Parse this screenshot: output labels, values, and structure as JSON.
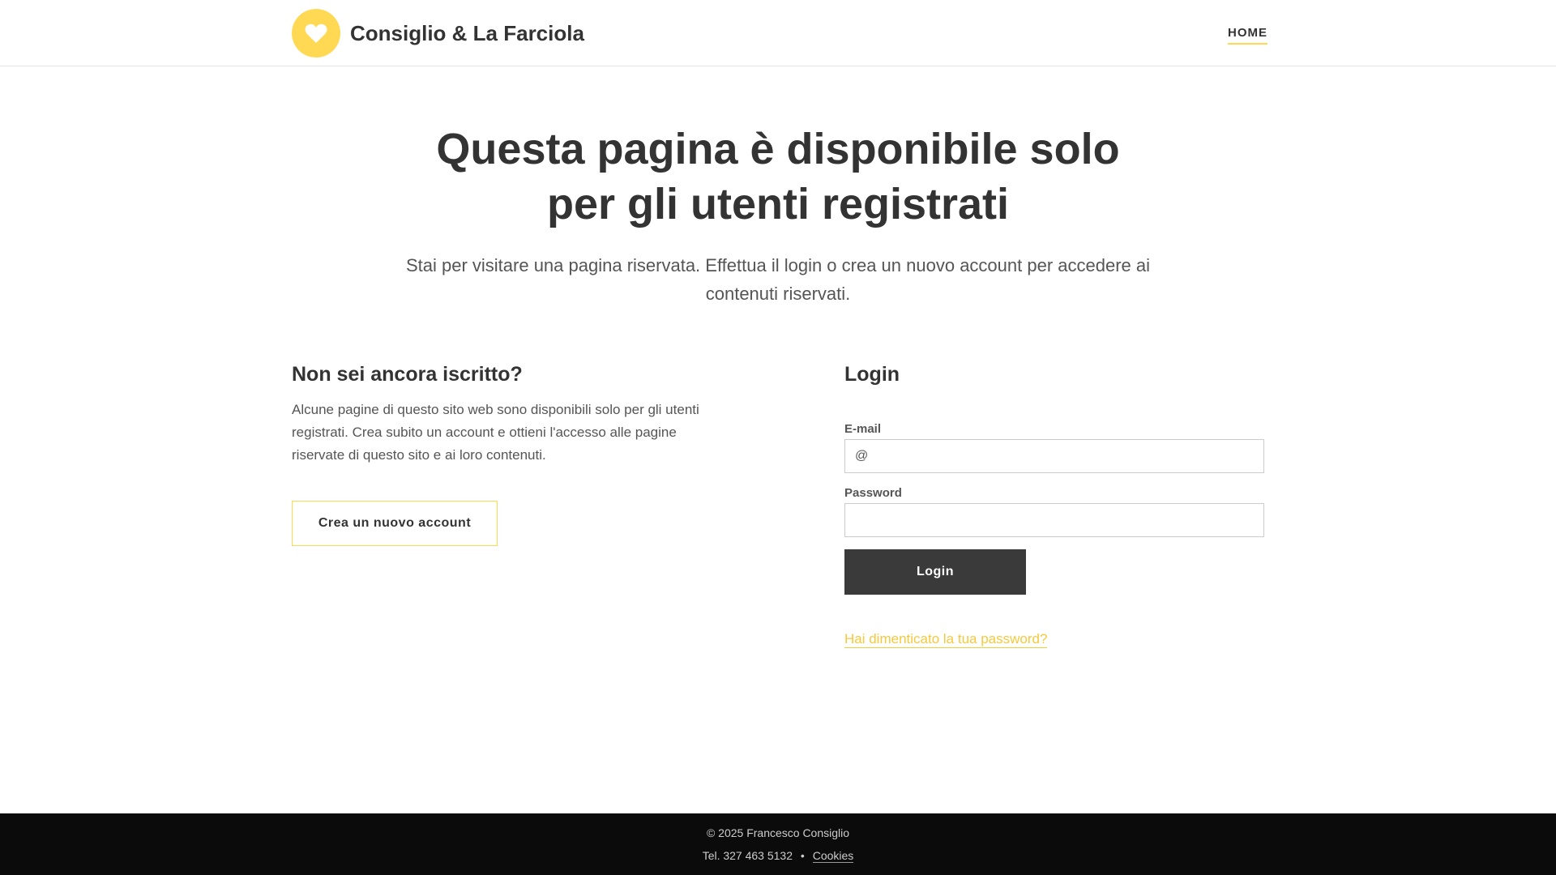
{
  "header": {
    "brand_name": "Consiglio & La Farciola",
    "nav_home": "HOME"
  },
  "hero": {
    "title": "Questa pagina è disponibile solo per gli utenti registrati",
    "subtitle": "Stai per visitare una pagina riservata. Effettua il login o crea un nuovo account per accedere ai contenuti riservati."
  },
  "register": {
    "heading": "Non sei ancora iscritto?",
    "text": "Alcune pagine di questo sito web sono disponibili solo per gli utenti registrati. Crea subito un account e ottieni l'accesso alle pagine riservate di questo sito e ai loro contenuti.",
    "button": "Crea un nuovo account"
  },
  "login": {
    "heading": "Login",
    "email_label": "E-mail",
    "email_placeholder": "@",
    "password_label": "Password",
    "password_placeholder": "",
    "button": "Login",
    "forgot": "Hai dimenticato la tua password?"
  },
  "footer": {
    "copyright": "© 2025 Francesco Consiglio",
    "phone": "Tel. 327 463 5132",
    "separator": "•",
    "cookies": "Cookies"
  },
  "colors": {
    "accent": "#ffd954",
    "dark_button": "#3a3a3a",
    "footer_bg": "#0b0b0b"
  },
  "icons": {
    "logo": "heart-icon"
  }
}
